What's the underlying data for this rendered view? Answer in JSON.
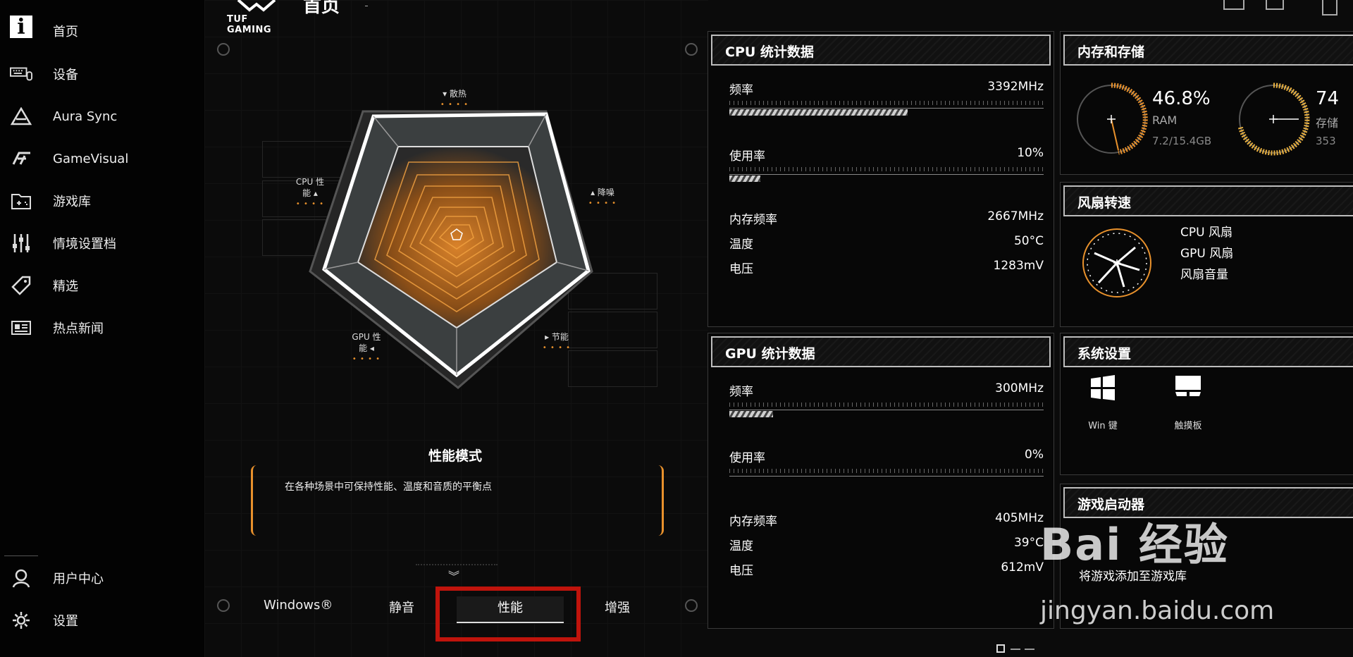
{
  "sidebar": {
    "items": [
      {
        "label": "首页",
        "icon": "info-icon"
      },
      {
        "label": "设备",
        "icon": "keyboard-mouse-icon"
      },
      {
        "label": "Aura Sync",
        "icon": "aura-icon"
      },
      {
        "label": "GameVisual",
        "icon": "gamevisual-icon"
      },
      {
        "label": "游戏库",
        "icon": "game-library-icon"
      },
      {
        "label": "情境设置档",
        "icon": "sliders-icon"
      },
      {
        "label": "精选",
        "icon": "tag-icon"
      },
      {
        "label": "热点新闻",
        "icon": "news-icon"
      }
    ],
    "bottom": [
      {
        "label": "用户中心",
        "icon": "user-icon"
      },
      {
        "label": "设置",
        "icon": "gear-icon"
      }
    ]
  },
  "header": {
    "logo": "TUF GAMING",
    "title": "首页"
  },
  "pentagon": {
    "labels": {
      "top": "散热",
      "right": "降噪",
      "left": "CPU 性能",
      "bottom_left": "GPU 性能",
      "bottom_right": "节能"
    }
  },
  "mode": {
    "title": "性能模式",
    "description": "在各种场景中可保持性能、温度和音质的平衡点"
  },
  "mode_tabs": [
    "Windows®",
    "静音",
    "性能",
    "增强"
  ],
  "selected_tab": "性能",
  "cpu": {
    "title": "CPU 统计数据",
    "freq_label": "频率",
    "freq": "3392MHz",
    "freq_fill": 0.57,
    "usage_label": "使用率",
    "usage": "10%",
    "usage_fill": 0.1,
    "mem_freq_label": "内存频率",
    "mem_freq": "2667MHz",
    "temp_label": "温度",
    "temp": "50°C",
    "voltage_label": "电压",
    "voltage": "1283mV"
  },
  "gpu": {
    "title": "GPU 统计数据",
    "freq_label": "频率",
    "freq": "300MHz",
    "freq_fill": 0.14,
    "usage_label": "使用率",
    "usage": "0%",
    "mem_freq_label": "内存频率",
    "mem_freq": "405MHz",
    "temp_label": "温度",
    "temp": "39°C",
    "voltage_label": "电压",
    "voltage": "612mV"
  },
  "memory": {
    "title": "内存和存储",
    "ram_percent": "46.8%",
    "ram_label": "RAM",
    "ram_detail": "7.2/15.4GB",
    "storage_percent": "74",
    "storage_label": "存储",
    "storage_detail": "353"
  },
  "fan": {
    "title": "风扇转速",
    "items": [
      "CPU 风扇",
      "GPU 风扇",
      "风扇音量"
    ]
  },
  "system": {
    "title": "系统设置",
    "win_key": "Win 键",
    "touchpad": "触摸板"
  },
  "launcher": {
    "title": "游戏启动器",
    "hint": "将游戏添加至游戏库"
  },
  "watermark": {
    "text": "Bai 经验",
    "sub": "jingyan.baidu.com"
  },
  "colors": {
    "accent": "#e8912c",
    "highlight": "#c0140c"
  }
}
